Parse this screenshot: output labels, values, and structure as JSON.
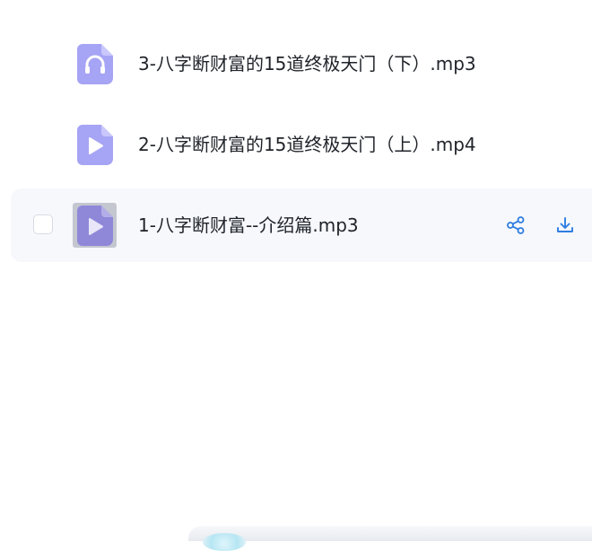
{
  "files": [
    {
      "name": "3-八字断财富的15道终极天门（下）.mp3",
      "type": "audio",
      "icon": "headphones-icon"
    },
    {
      "name": "2-八字断财富的15道终极天门（上）.mp4",
      "type": "video",
      "icon": "play-icon"
    },
    {
      "name": "1-八字断财富--介绍篇.mp3",
      "type": "audio",
      "icon": "play-icon",
      "hovered": true,
      "actions": [
        "share-icon",
        "download-icon"
      ]
    }
  ],
  "colors": {
    "file_icon": "#a6a4f4",
    "file_icon_dark": "#8f88d9",
    "action_blue": "#2f7de1",
    "hover_row": "#f6f8fc"
  }
}
